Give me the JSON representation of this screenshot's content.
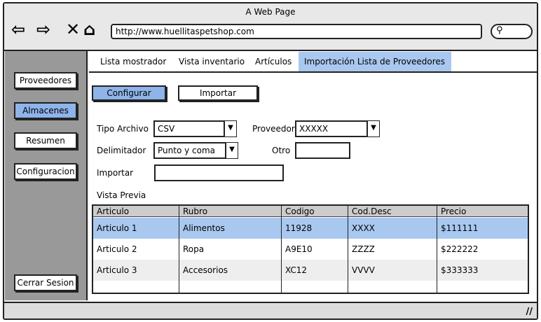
{
  "window": {
    "title": "A Web Page",
    "url": "http://www.huellitaspetshop.com"
  },
  "sidebar": {
    "items": [
      {
        "label": "Proveedores"
      },
      {
        "label": "Almacenes"
      },
      {
        "label": "Resumen"
      },
      {
        "label": "Configuracion"
      }
    ],
    "logout": "Cerrar Sesion"
  },
  "tabs": [
    {
      "label": "Lista mostrador"
    },
    {
      "label": "Vista inventario"
    },
    {
      "label": "Artículos"
    },
    {
      "label": "Importación Lista de Proveedores"
    }
  ],
  "actions": {
    "configurar": "Configurar",
    "importar": "Importar"
  },
  "form": {
    "tipo_label": "Tipo Archivo",
    "tipo_value": "CSV",
    "proveedor_label": "Proveedor",
    "proveedor_value": "XXXXX",
    "delim_label": "Delimitador",
    "delim_value": "Punto y coma",
    "otro_label": "Otro",
    "otro_value": "",
    "importar_label": "Importar",
    "importar_value": ""
  },
  "preview": {
    "label": "Vista Previa",
    "columns": [
      "Articulo",
      "Rubro",
      "Codigo",
      "Cod.Desc",
      "Precio"
    ],
    "rows": [
      [
        "Articulo 1",
        "Alimentos",
        "11928",
        "XXXX",
        "$111111"
      ],
      [
        "Articulo 2",
        "Ropa",
        "A9E10",
        "ZZZZ",
        "$222222"
      ],
      [
        "Articulo 3",
        "Accesorios",
        "XC12",
        "VVVV",
        "$333333"
      ]
    ]
  },
  "colors": {
    "selection": "#a9c8f0",
    "button_active": "#8eb4ea",
    "sidebar": "#999999"
  }
}
